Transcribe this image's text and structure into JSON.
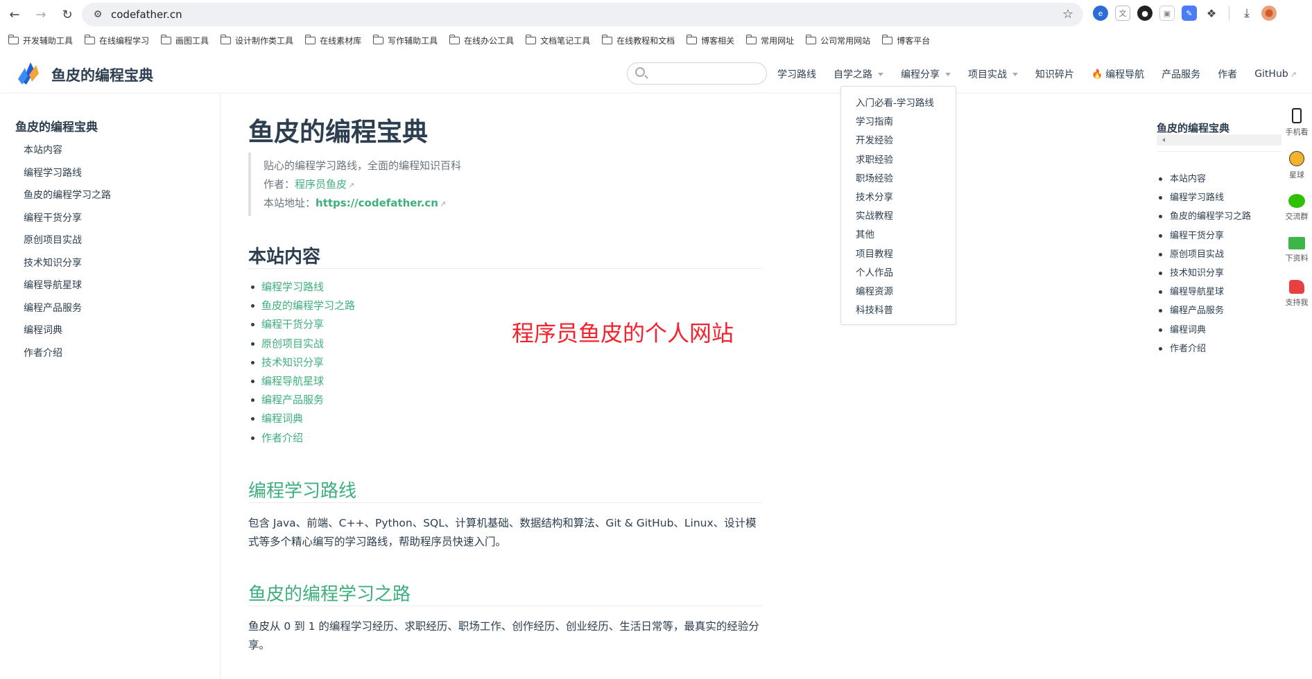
{
  "browser": {
    "url": "codefather.cn",
    "bookmarks": [
      "开发辅助工具",
      "在线编程学习",
      "画图工具",
      "设计制作类工具",
      "在线素材库",
      "写作辅助工具",
      "在线办公工具",
      "文档笔记工具",
      "在线教程和文档",
      "博客相关",
      "常用网址",
      "公司常用网站",
      "博客平台"
    ]
  },
  "header": {
    "site_title": "鱼皮的编程宝典",
    "search_placeholder": "",
    "nav": {
      "learning_path": "学习路线",
      "self_study": "自学之路",
      "programming_share": "编程分享",
      "projects": "项目实战",
      "knowledge": "知识碎片",
      "navigation": "编程导航",
      "products": "产品服务",
      "author": "作者",
      "github": "GitHub"
    }
  },
  "dropdown": {
    "items": [
      "入门必看-学习路线",
      "学习指南",
      "开发经验",
      "求职经验",
      "职场经验",
      "技术分享",
      "实战教程",
      "其他",
      "项目教程",
      "个人作品",
      "编程资源",
      "科技科普"
    ]
  },
  "sidebar": {
    "title": "鱼皮的编程宝典",
    "items": [
      "本站内容",
      "编程学习路线",
      "鱼皮的编程学习之路",
      "编程干货分享",
      "原创项目实战",
      "技术知识分享",
      "编程导航星球",
      "编程产品服务",
      "编程词典",
      "作者介绍"
    ]
  },
  "main": {
    "title": "鱼皮的编程宝典",
    "quote": {
      "line1": "贴心的编程学习路线，全面的编程知识百科",
      "author_label": "作者：",
      "author_link": "程序员鱼皮",
      "site_label": "本站地址：",
      "site_link": "https://codefather.cn"
    },
    "section1_title": "本站内容",
    "toc": [
      "编程学习路线",
      "鱼皮的编程学习之路",
      "编程干货分享",
      "原创项目实战",
      "技术知识分享",
      "编程导航星球",
      "编程产品服务",
      "编程词典",
      "作者介绍"
    ],
    "section2_title": "编程学习路线",
    "section2_text": "包含 Java、前端、C++、Python、SQL、计算机基础、数据结构和算法、Git & GitHub、Linux、设计模式等多个精心编写的学习路线，帮助程序员快速入门。",
    "section3_title": "鱼皮的编程学习之路",
    "section3_text": "鱼皮从 0 到 1 的编程学习经历、求职经历、职场工作、创作经历、创业经历、生活日常等，最真实的经验分享。",
    "watermark": "程序员鱼皮的个人网站"
  },
  "right_toc": {
    "title": "鱼皮的编程宝典",
    "items": [
      "本站内容",
      "编程学习路线",
      "鱼皮的编程学习之路",
      "编程干货分享",
      "原创项目实战",
      "技术知识分享",
      "编程导航星球",
      "编程产品服务",
      "编程词典",
      "作者介绍"
    ]
  },
  "floatbar": {
    "phone": "手机看",
    "planet": "星球",
    "group": "交流群",
    "download": "下资料",
    "support": "支持我"
  }
}
